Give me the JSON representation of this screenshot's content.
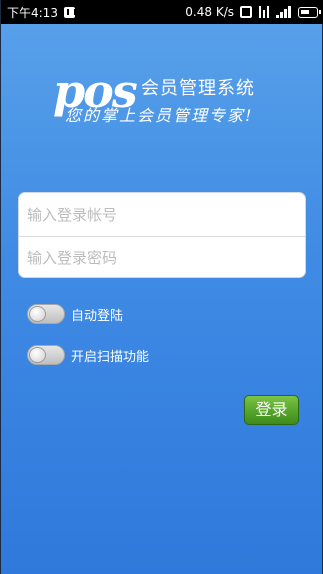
{
  "statusbar": {
    "time": "下午4:13",
    "speed": "0.48 K/s"
  },
  "logo": {
    "pos_text": "pos",
    "title": "会员管理系统",
    "slogan": "您的掌上会员管理专家!"
  },
  "login": {
    "account_placeholder": "输入登录帐号",
    "password_placeholder": "输入登录密码",
    "auto_login_label": "自动登陆",
    "scan_label": "开启扫描功能",
    "submit_label": "登录"
  },
  "colors": {
    "background": "#3f8be4",
    "button": "#55a42a"
  }
}
